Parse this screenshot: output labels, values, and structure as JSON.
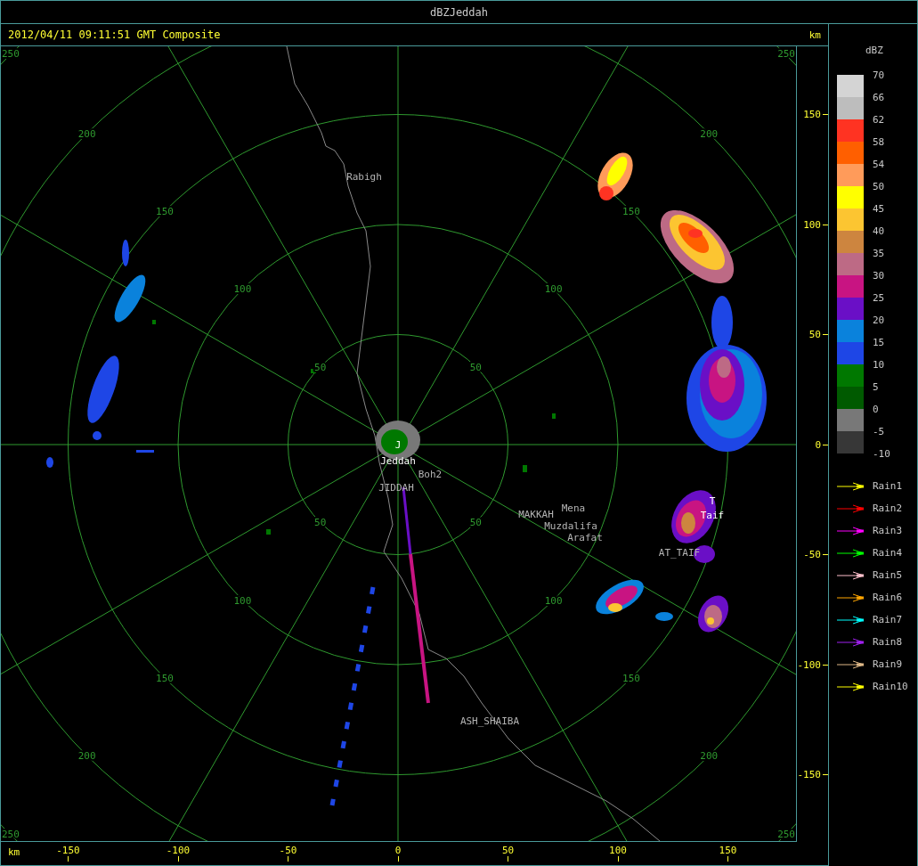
{
  "window": {
    "title": "dBZJeddah"
  },
  "header": {
    "timestamp": "2012/04/11 09:11:51 GMT Composite"
  },
  "plot": {
    "range_rings": [
      {
        "labels": [
          "50",
          "50",
          "50",
          "50"
        ]
      },
      {
        "labels": [
          "100",
          "100",
          "100",
          "100"
        ]
      },
      {
        "labels": [
          "150",
          "150",
          "150",
          "150"
        ]
      },
      {
        "labels": [
          "200",
          "200",
          "200",
          "200"
        ]
      },
      {
        "labels": [
          "250",
          "250",
          "250",
          "250"
        ]
      }
    ],
    "places": [
      {
        "label": "Rabigh",
        "kind": "map"
      },
      {
        "label": "J",
        "kind": "site"
      },
      {
        "label": "Jeddah",
        "kind": "site"
      },
      {
        "label": "Boh2",
        "kind": "map"
      },
      {
        "label": "JIDDAH",
        "kind": "map"
      },
      {
        "label": "MAKKAH",
        "kind": "map"
      },
      {
        "label": "Mena",
        "kind": "map"
      },
      {
        "label": "Muzdalifa",
        "kind": "map"
      },
      {
        "label": "Arafat",
        "kind": "map"
      },
      {
        "label": "T",
        "kind": "site"
      },
      {
        "label": "Taif",
        "kind": "site"
      },
      {
        "label": "AT_TAIF",
        "kind": "map"
      },
      {
        "label": "ASH_SHAIBA",
        "kind": "map"
      }
    ]
  },
  "y_axis": {
    "unit": "km",
    "ticks": [
      "150",
      "100",
      "50",
      "0",
      "-50",
      "-100",
      "-150"
    ]
  },
  "x_axis": {
    "unit": "km",
    "ticks": [
      "-150",
      "-100",
      "-50",
      "0",
      "50",
      "100",
      "150"
    ]
  },
  "legend": {
    "title": "dBZ",
    "ticks": [
      "70",
      "66",
      "62",
      "58",
      "54",
      "50",
      "45",
      "40",
      "35",
      "30",
      "25",
      "20",
      "15",
      "10",
      "5",
      "0",
      "-5",
      "-10"
    ],
    "bins": [
      {
        "color": "#d4d4d4"
      },
      {
        "color": "#bdbdbd"
      },
      {
        "color": "#ff3322"
      },
      {
        "color": "#ff5f00"
      },
      {
        "color": "#ff9b5a"
      },
      {
        "color": "#ffff00"
      },
      {
        "color": "#fcc531"
      },
      {
        "color": "#cd853f"
      },
      {
        "color": "#bd6a85"
      },
      {
        "color": "#c81482"
      },
      {
        "color": "#6a0fc6"
      },
      {
        "color": "#0a82dc"
      },
      {
        "color": "#1e46e6"
      },
      {
        "color": "#007800"
      },
      {
        "color": "#005a00"
      },
      {
        "color": "#787878"
      },
      {
        "color": "#373737"
      }
    ],
    "tracks": [
      {
        "label": "Rain1",
        "color": "#ffff00"
      },
      {
        "label": "Rain2",
        "color": "#ff0000"
      },
      {
        "label": "Rain3",
        "color": "#ff00ff"
      },
      {
        "label": "Rain4",
        "color": "#00ff00"
      },
      {
        "label": "Rain5",
        "color": "#ffc0cb"
      },
      {
        "label": "Rain6",
        "color": "#ffa500"
      },
      {
        "label": "Rain7",
        "color": "#00ffff"
      },
      {
        "label": "Rain8",
        "color": "#a020f0"
      },
      {
        "label": "Rain9",
        "color": "#deb887"
      },
      {
        "label": "Rain10",
        "color": "#ffff00"
      }
    ]
  }
}
